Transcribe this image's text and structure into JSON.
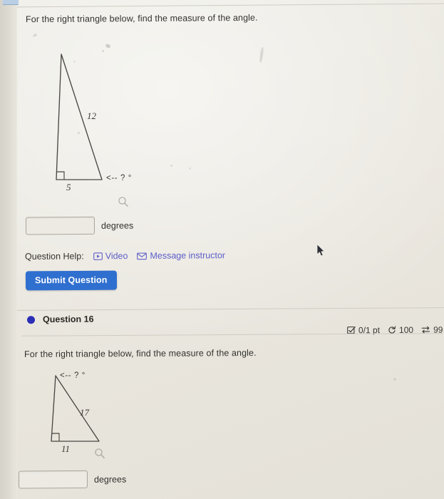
{
  "page": {
    "background_color": "#eae7df",
    "accent_blue": "#2f6fcf",
    "link_purple": "#5d5ec9",
    "bullet_color": "#2b2fb5"
  },
  "question_15": {
    "prompt": "For the right triangle below, find the measure of the angle.",
    "figure": {
      "leg_bottom_label": "5",
      "hypotenuse_label": "12",
      "angle_marker": "<-- ? °",
      "right_angle_marker": true,
      "zoom_icon": "magnifier-icon"
    },
    "answer": {
      "value": "",
      "placeholder": "",
      "unit": "degrees"
    },
    "help": {
      "label": "Question Help:",
      "video_link": "Video",
      "video_icon": "video-play-icon",
      "message_link": "Message instructor",
      "message_icon": "envelope-icon"
    },
    "submit_label": "Submit Question"
  },
  "question_16": {
    "title": "Question 16",
    "bullet": "status-dot",
    "meta": {
      "points": "0/1 pt",
      "points_icon": "checkbox-icon",
      "attempts": "100",
      "attempts_icon": "retry-arrow-icon",
      "versions": "99",
      "versions_icon": "swap-arrows-icon"
    },
    "prompt": "For the right triangle below, find the measure of the angle.",
    "figure": {
      "leg_bottom_label": "11",
      "hypotenuse_label": "17",
      "angle_marker": "<-- ? °",
      "right_angle_marker": true,
      "zoom_icon": "magnifier-icon"
    },
    "answer": {
      "value": "",
      "placeholder": "",
      "unit": "degrees"
    }
  }
}
